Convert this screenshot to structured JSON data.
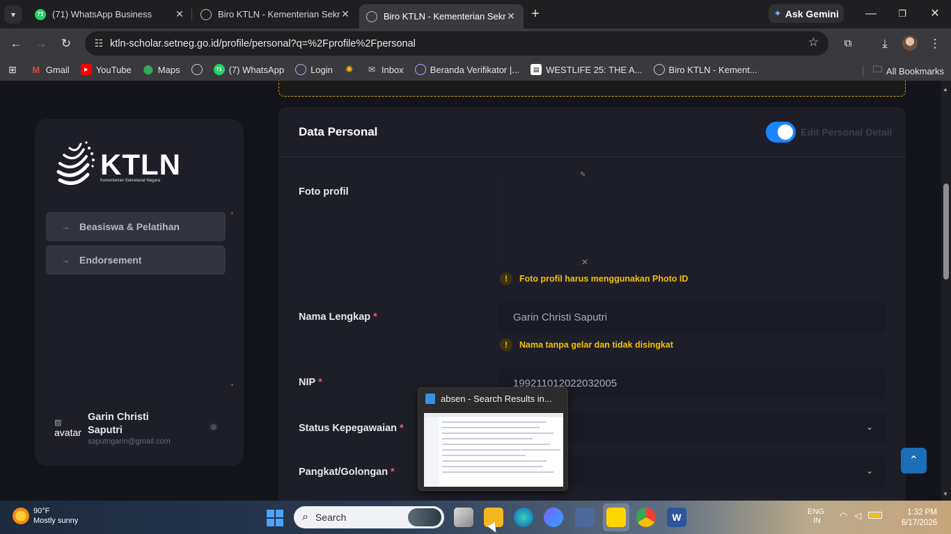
{
  "browser": {
    "tabs": [
      {
        "favicon_badge": "71",
        "title": "(71) WhatsApp Business"
      },
      {
        "title": "Biro KTLN - Kementerian Sekretariat Negara"
      },
      {
        "title": "Biro KTLN - Kementerian Sekretariat Negara"
      }
    ],
    "ask_gemini": "Ask Gemini",
    "url": "ktln-scholar.setneg.go.id/profile/personal?q=%2Fprofile%2Fpersonal",
    "bookmarks": [
      {
        "label": "Gmail",
        "icon": "gmail-icon"
      },
      {
        "label": "YouTube",
        "icon": "youtube-icon"
      },
      {
        "label": "Maps",
        "icon": "maps-icon"
      },
      {
        "label": "",
        "icon": "globe-icon"
      },
      {
        "label": "(7) WhatsApp",
        "icon": "whatsapp-icon"
      },
      {
        "label": "Login",
        "icon": "login-site-icon"
      },
      {
        "label": "",
        "icon": "pinwheel-icon"
      },
      {
        "label": "Inbox",
        "icon": "mail-icon"
      },
      {
        "label": "Beranda Verifikator |...",
        "icon": "site-icon"
      },
      {
        "label": "WESTLIFE 25: THE A...",
        "icon": "bookmark-page-icon"
      },
      {
        "label": "Biro KTLN - Kement...",
        "icon": "globe-icon"
      }
    ],
    "all_bookmarks": "All Bookmarks"
  },
  "sidebar": {
    "logo_text": "KTLN",
    "logo_subtitle": "Kementerian Sekretariat Negara",
    "menu": [
      {
        "label": "Beasiswa & Pelatihan"
      },
      {
        "label": "Endorsement"
      }
    ],
    "user": {
      "avatar_alt": "avatar",
      "name": "Garin Christi Saputri",
      "email": "saputrigarin@gmail.com"
    }
  },
  "form": {
    "title": "Data Personal",
    "toggle_label": "Edit Personal Detail",
    "toggle_on": true,
    "photo_label": "Foto profil",
    "photo_hint": "Foto profil harus menggunakan Photo ID",
    "name_label": "Nama Lengkap",
    "name_value": "Garin Christi Saputri",
    "name_hint": "Nama tanpa gelar dan tidak disingkat",
    "nip_label": "NIP",
    "nip_value": "199211012022032005",
    "status_label": "Status Kepegawaian",
    "rank_label": "Pangkat/Golongan",
    "required_mark": "*"
  },
  "thumbnail_popup": {
    "title": "absen - Search Results in..."
  },
  "taskbar": {
    "weather_temp": "90°F",
    "weather_desc": "Mostly sunny",
    "search_placeholder": "Search",
    "lang": "ENG",
    "region": "IN",
    "time": "1:32 PM",
    "date": "6/17/2026"
  },
  "colors": {
    "accent": "#1b84ff",
    "warning": "#f6c000",
    "required": "#f15a6e",
    "card_bg": "#1e1e29",
    "page_bg": "#14141d"
  }
}
